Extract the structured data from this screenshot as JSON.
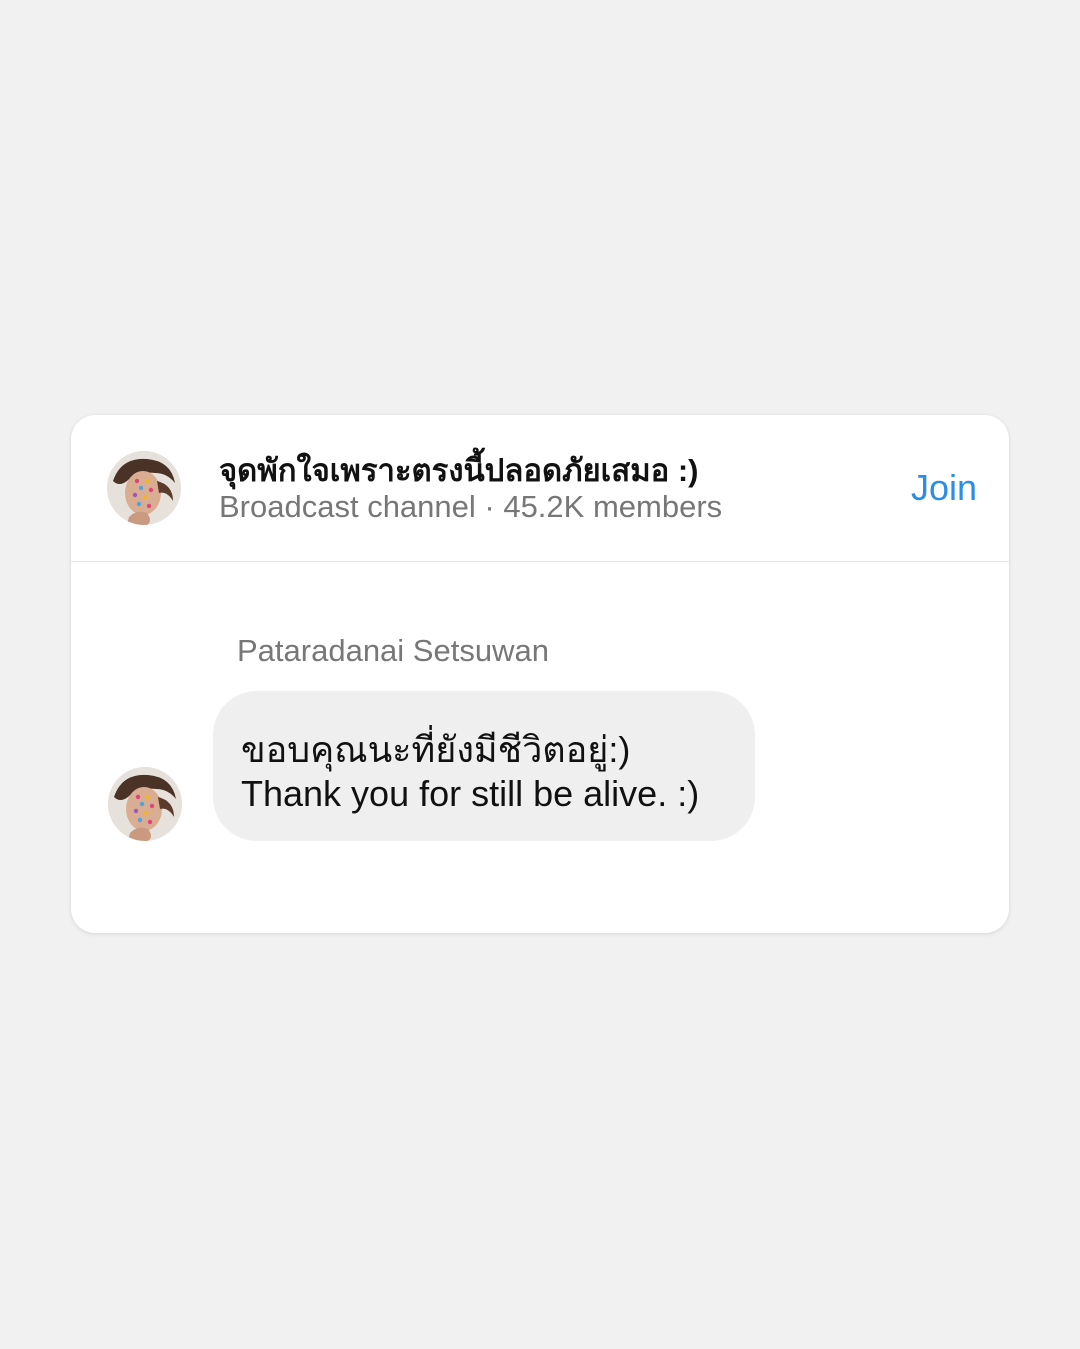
{
  "channel": {
    "name": "จุดพักใจเพราะตรงนี้ปลอดภัยเสมอ :)",
    "meta": "Broadcast channel · 45.2K members",
    "join_label": "Join",
    "avatar_icon": "profile-photo-avatar"
  },
  "message": {
    "sender": "Pataradanai Setsuwan",
    "lines": [
      "ขอบคุณนะที่ยังมีชีวิตอยู่:)",
      "Thank you for still be alive. :)"
    ],
    "avatar_icon": "profile-photo-avatar"
  },
  "colors": {
    "background": "#f1f1f1",
    "card": "#ffffff",
    "accent": "#2a8ee8",
    "bubble": "#efefef",
    "secondary_text": "#777777"
  }
}
